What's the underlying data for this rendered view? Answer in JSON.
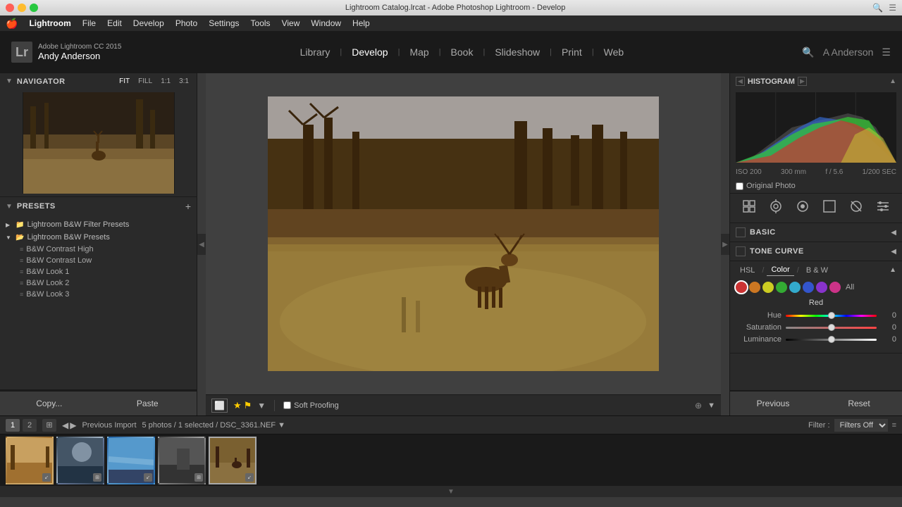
{
  "titlebar": {
    "title": "Lightroom Catalog.lrcat - Adobe Photoshop Lightroom - Develop",
    "traffic": [
      "close",
      "minimize",
      "maximize"
    ]
  },
  "menubar": {
    "apple": "🍎",
    "appname": "Lightroom",
    "items": [
      "File",
      "Edit",
      "Develop",
      "Photo",
      "Settings",
      "Tools",
      "View",
      "Window",
      "Help"
    ]
  },
  "header": {
    "app_version": "Adobe Lightroom CC 2015",
    "user_name": "Andy Anderson",
    "lr_badge": "Lr",
    "nav_items": [
      "Library",
      "Develop",
      "Map",
      "Book",
      "Slideshow",
      "Print",
      "Web"
    ],
    "active_nav": "Develop",
    "right_icons": [
      "search-icon",
      "menu-icon"
    ]
  },
  "left_panel": {
    "navigator": {
      "title": "Navigator",
      "zoom_levels": [
        "FIT",
        "FILL",
        "1:1",
        "3:1"
      ]
    },
    "presets": {
      "title": "Presets",
      "add_btn": "+",
      "folders": [
        {
          "name": "Lightroom B&W Filter Presets",
          "expanded": false,
          "items": []
        },
        {
          "name": "Lightroom B&W Presets",
          "expanded": true,
          "items": [
            "B&W Contrast High",
            "B&W Contrast Low",
            "B&W Look 1",
            "B&W Look 2",
            "B&W Look 3"
          ]
        }
      ]
    }
  },
  "bottom_panel": {
    "copy_btn": "Copy...",
    "paste_btn": "Paste",
    "soft_proofing_label": "Soft Proofing"
  },
  "right_panel": {
    "histogram": {
      "title": "Histogram",
      "iso": "ISO 200",
      "focal": "300 mm",
      "aperture": "f / 5.6",
      "shutter": "1/200 SEC",
      "original_photo_label": "Original Photo"
    },
    "basic": {
      "title": "Basic"
    },
    "tone_curve": {
      "title": "Tone Curve"
    },
    "hsl": {
      "tabs": [
        "HSL",
        "Color",
        "B & W"
      ],
      "color_dots": [
        {
          "color": "#cc3333",
          "label": "Red"
        },
        {
          "color": "#cc7722",
          "label": "Orange"
        },
        {
          "color": "#cccc22",
          "label": "Yellow"
        },
        {
          "color": "#33aa33",
          "label": "Green"
        },
        {
          "color": "#33aacc",
          "label": "Aqua"
        },
        {
          "color": "#3355cc",
          "label": "Blue"
        },
        {
          "color": "#8833cc",
          "label": "Purple"
        },
        {
          "color": "#cc3388",
          "label": "Magenta"
        },
        {
          "color": "#ffffff",
          "label": "All"
        }
      ],
      "active_color": "Red",
      "sliders": [
        {
          "label": "Hue",
          "value": "0",
          "position": 50
        },
        {
          "label": "Saturation",
          "value": "0",
          "position": 50
        },
        {
          "label": "Luminance",
          "value": "0",
          "position": 50
        }
      ]
    },
    "buttons": {
      "previous": "Previous",
      "reset": "Reset"
    }
  },
  "filmstrip": {
    "pages": [
      "1",
      "2"
    ],
    "import_info": "Previous Import",
    "photo_count": "5 photos / 1 selected",
    "file_name": "DSC_3361.NEF",
    "filter_label": "Filter :",
    "filter_value": "Filters Off",
    "thumbnails": [
      {
        "id": 1,
        "style": "thumb-1",
        "badge": "↙"
      },
      {
        "id": 2,
        "style": "thumb-2",
        "badge": "⊞"
      },
      {
        "id": 3,
        "style": "thumb-3",
        "badge": "↙"
      },
      {
        "id": 4,
        "style": "thumb-4",
        "badge": "⊞"
      },
      {
        "id": 5,
        "style": "thumb-5",
        "badge": "↙",
        "selected": true
      }
    ]
  }
}
